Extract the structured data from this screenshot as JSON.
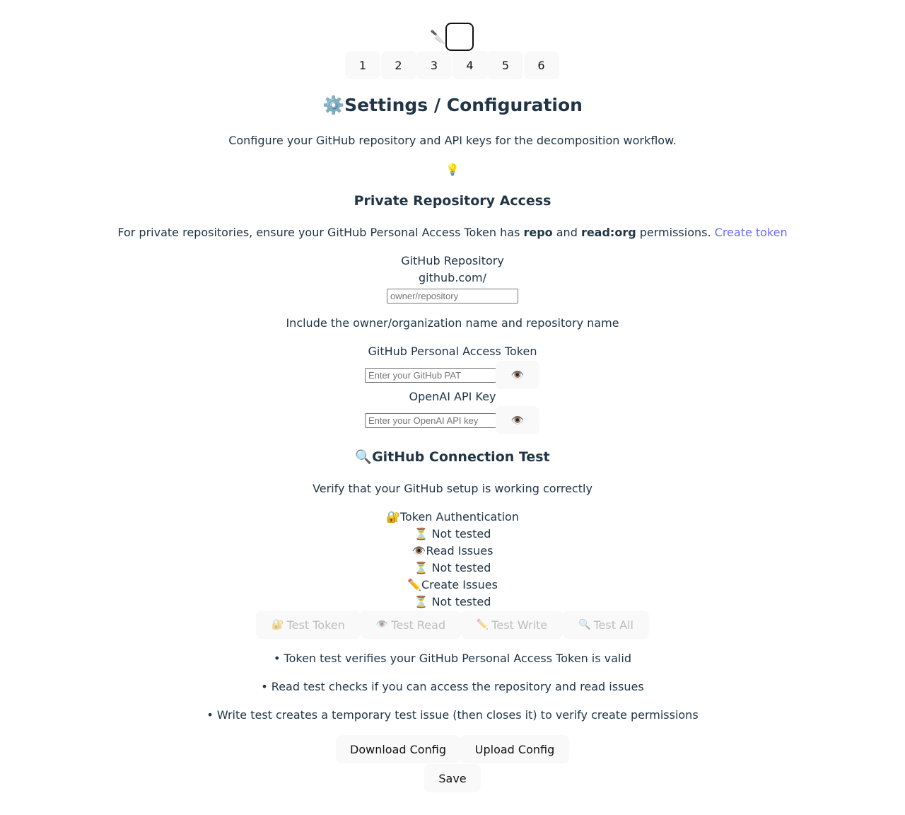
{
  "logo": {
    "icon": "knife-icon"
  },
  "steps": [
    "1",
    "2",
    "3",
    "4",
    "5",
    "6"
  ],
  "title": "Settings / Configuration",
  "title_icon": "⚙️",
  "description": "Configure your GitHub repository and API keys for the decomposition workflow.",
  "tip_icon": "💡",
  "private_access": {
    "heading": "Private Repository Access",
    "text_before": "For private repositories, ensure your GitHub Personal Access Token has ",
    "perm1": "repo",
    "and": " and ",
    "perm2": "read:org",
    "text_after": " permissions. ",
    "link": "Create token"
  },
  "repo": {
    "label": "GitHub Repository",
    "prefix": "github.com/",
    "placeholder": "owner/repository",
    "hint": "Include the owner/organization name and repository name"
  },
  "pat": {
    "label": "GitHub Personal Access Token",
    "placeholder": "Enter your GitHub PAT",
    "toggle_icon": "👁️"
  },
  "openai": {
    "label": "OpenAI API Key",
    "placeholder": "Enter your OpenAI API key",
    "toggle_icon": "👁️"
  },
  "connection_test": {
    "icon": "🔍",
    "heading": "GitHub Connection Test",
    "description": "Verify that your GitHub setup is working correctly",
    "checks": [
      {
        "icon": "🔐",
        "label": "Token Authentication",
        "status": "⏳ Not tested"
      },
      {
        "icon": "👁️",
        "label": "Read Issues",
        "status": "⏳ Not tested"
      },
      {
        "icon": "✏️",
        "label": "Create Issues",
        "status": "⏳ Not tested"
      }
    ],
    "buttons": [
      {
        "icon": "🔐",
        "label": "Test Token"
      },
      {
        "icon": "👁️",
        "label": "Test Read"
      },
      {
        "icon": "✏️",
        "label": "Test Write"
      },
      {
        "icon": "🔍",
        "label": "Test All"
      }
    ],
    "notes": [
      "• Token test verifies your GitHub Personal Access Token is valid",
      "• Read test checks if you can access the repository and read issues",
      "• Write test creates a temporary test issue (then closes it) to verify create permissions"
    ]
  },
  "actions": {
    "download": "Download Config",
    "upload": "Upload Config",
    "save": "Save"
  }
}
